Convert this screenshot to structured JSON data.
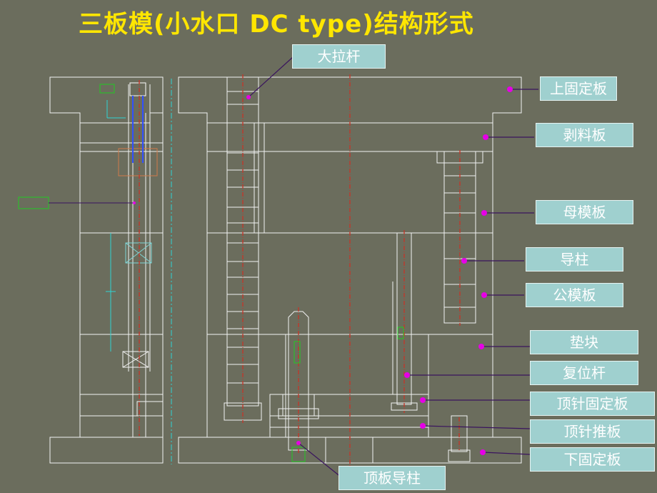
{
  "title": "三板模(小水口 DC type)结构形式",
  "labels": {
    "tie_rod": "大拉杆",
    "top_clamp_plate": "上固定板",
    "stripper_plate": "剥料板",
    "cavity_plate": "母模板",
    "guide_pillar": "导柱",
    "core_plate": "公模板",
    "spacer_block": "垫块",
    "return_pin": "复位杆",
    "ejector_retainer_plate": "顶针固定板",
    "ejector_plate": "顶针推板",
    "bottom_clamp_plate": "下固定板",
    "ejector_guide_pillar": "顶板导柱"
  },
  "colors": {
    "background": "#6b6d5d",
    "title": "#ffe600",
    "drawing_lines": "#f2f2f2",
    "center_lines": "#c0392b",
    "label_fill": "#9fd0cf",
    "leader_line": "#3a145e",
    "leader_dot": "#e600e6",
    "dimension_lines": "#2fd4d4",
    "detail_lines": "#22cc22"
  }
}
